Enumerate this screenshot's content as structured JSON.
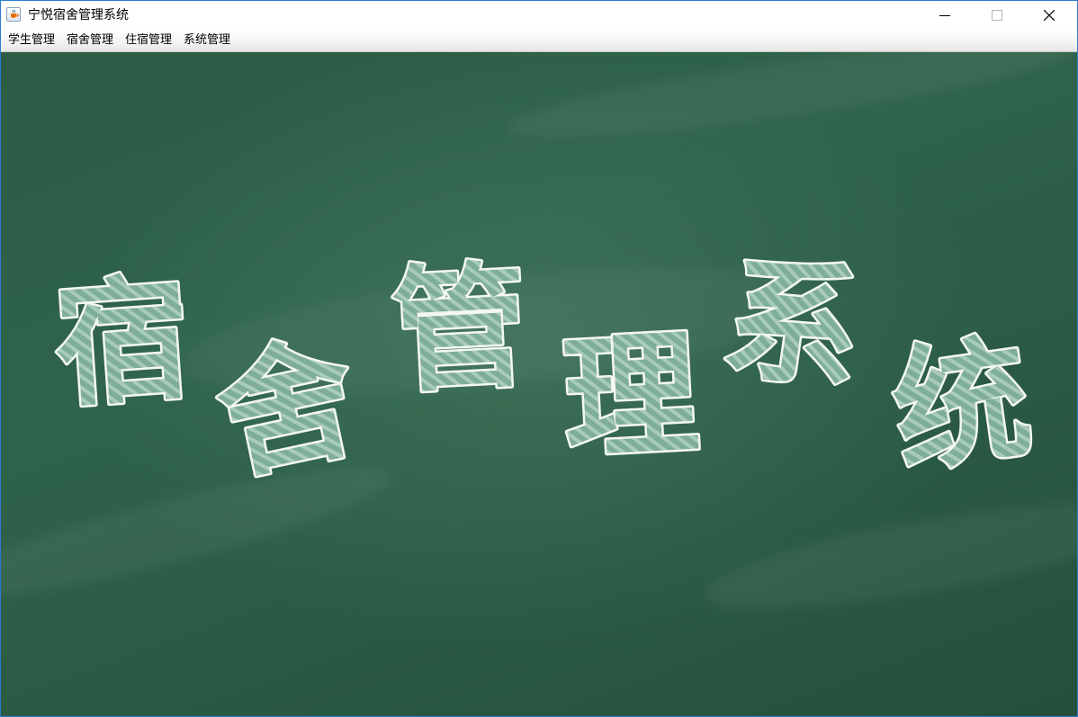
{
  "window": {
    "title": "宁悦宿舍管理系统",
    "icon": "java-coffee-icon",
    "controls": [
      "minimize-icon",
      "maximize-icon",
      "close-icon"
    ]
  },
  "menu": {
    "items": [
      {
        "label": "学生管理"
      },
      {
        "label": "宿舍管理"
      },
      {
        "label": "住宿管理"
      },
      {
        "label": "系统管理"
      }
    ]
  },
  "banner": {
    "chars": [
      "宿",
      "舍",
      "管",
      "理",
      "系",
      "统"
    ]
  },
  "colors": {
    "chalkboard": "#2d5e48",
    "chalk": "#f4f7f2",
    "window_border": "#2b7bd0"
  }
}
